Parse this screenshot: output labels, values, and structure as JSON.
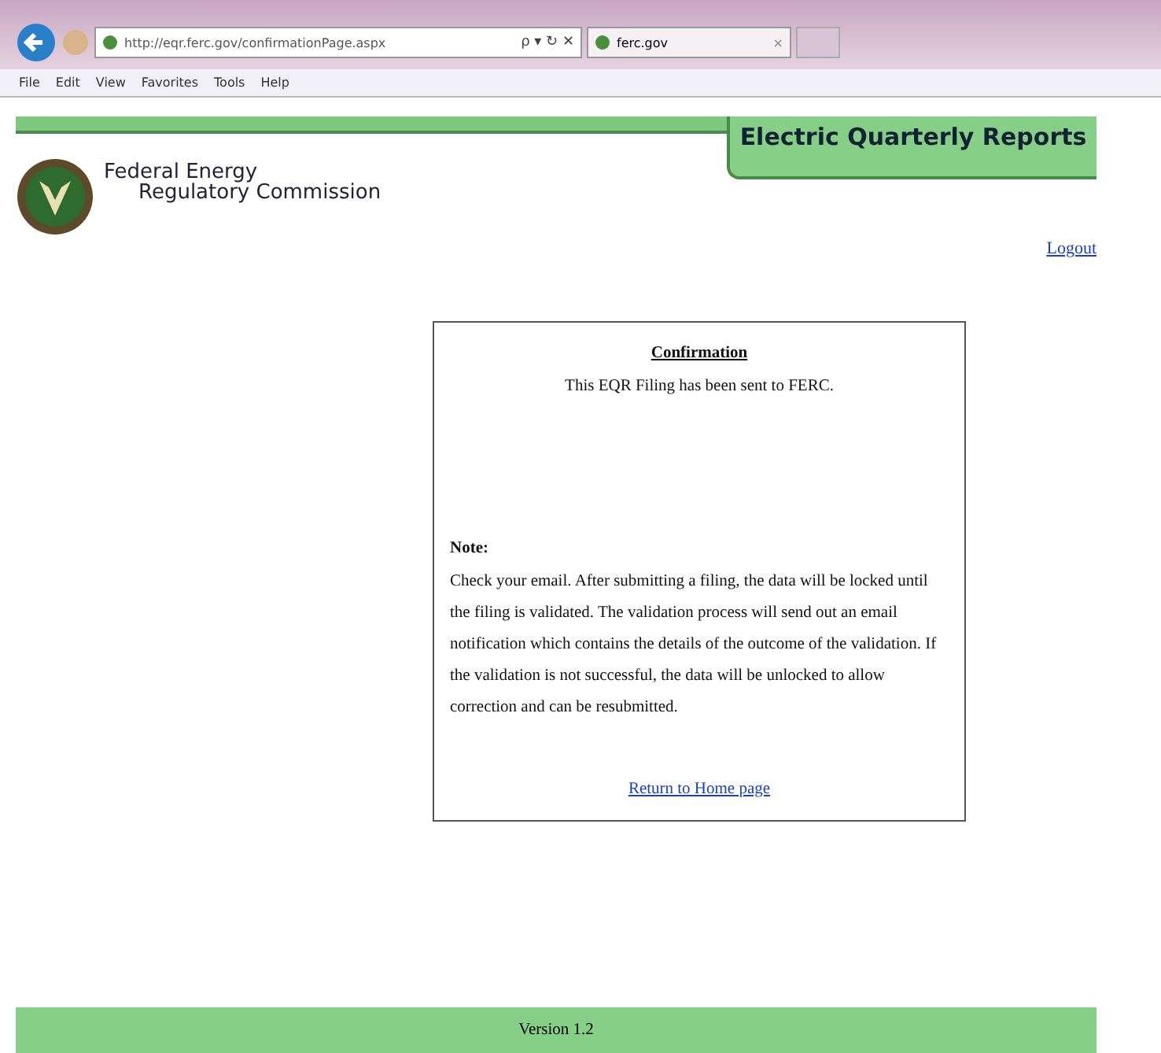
{
  "browser": {
    "address": "http://eqr.ferc.gov/confirmationPage.aspx",
    "tab_title": "ferc.gov",
    "address_controls": "ρ ▾ ↻ ✕",
    "tab_close": "×",
    "menu": [
      "File",
      "Edit",
      "View",
      "Favorites",
      "Tools",
      "Help"
    ]
  },
  "header": {
    "banner": "Electric Quarterly Reports",
    "org_line_1": "Federal Energy",
    "org_line_2": "Regulatory Commission",
    "logout": "Logout"
  },
  "dialog": {
    "title": "Confirmation",
    "message": "This EQR Filing has been sent to FERC.",
    "note_label": "Note:",
    "note": "Check your email. After submitting a filing, the data will be locked until the filing is validated. The validation process will send out an email notification which contains the details of the outcome of the validation. If the validation is not successful, the data will be unlocked to allow correction and can be resubmitted.",
    "link": "Return to Home page"
  },
  "footer": {
    "version": "Version 1.2"
  }
}
